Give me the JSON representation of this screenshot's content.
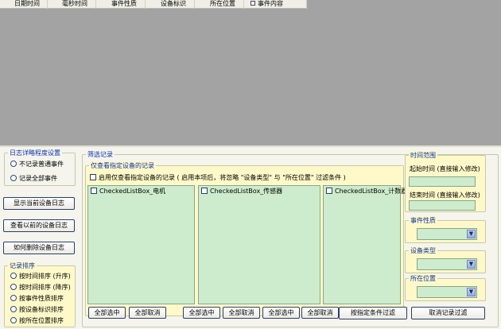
{
  "grid": {
    "columns": [
      "日期时间",
      "毫秒时间",
      "事件性质",
      "设备标识",
      "所在位置",
      "事件内容"
    ]
  },
  "detail_level": {
    "title": "日志详略程度设置",
    "options": [
      "不记录普通事件",
      "记录全部事件"
    ]
  },
  "left_buttons": {
    "show_current": "显示当前设备日志",
    "view_previous": "查看以前的设备日志",
    "how_delete": "如何删除设备日志"
  },
  "sort": {
    "title": "记录排序",
    "options": [
      "按时间排序 (升序)",
      "按时间排序 (降序)",
      "按事件性质排序",
      "按设备标识排序",
      "按所在位置排序"
    ]
  },
  "filter": {
    "title": "筛选记录",
    "device_group": {
      "title": "仅查看指定设备的记录",
      "enable_label": "启用仅查看指定设备的记录 ( 启用本项后，将忽略 \"设备类型\" 与 \"所在位置\" 过滤条件 )",
      "lists": [
        "CheckedListBox_电机",
        "CheckedListBox_传感器",
        "CheckedListBox_计数器"
      ]
    },
    "buttons": {
      "select_all": "全部选中",
      "cancel_all": "全部取消",
      "filter_by_condition": "按指定条件过滤",
      "cancel_filter": "取消记录过滤"
    }
  },
  "time_range": {
    "title": "时间范围",
    "start_label": "起始时间 (直接输入修改)",
    "end_label": "结束时间 (直接输入修改)",
    "start_value": "",
    "end_value": ""
  },
  "event_nature": {
    "title": "事件性质",
    "value": ""
  },
  "device_type": {
    "title": "设备类型",
    "value": ""
  },
  "location": {
    "title": "所在位置",
    "value": ""
  },
  "colors": {
    "grid_bg": "#a3a3a3",
    "panel_bg": "#f5f5ee",
    "group_bg": "#fff9c9",
    "list_bg": "#cdeccd",
    "legend_text": "#0a31a8"
  }
}
